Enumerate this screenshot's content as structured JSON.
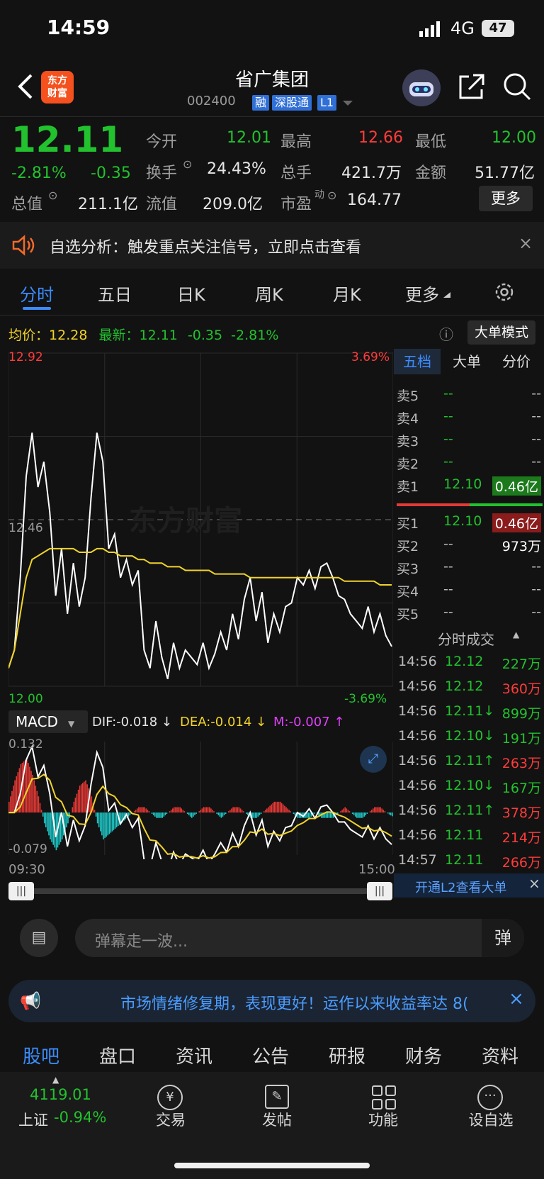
{
  "status": {
    "time": "14:59",
    "network": "4G",
    "battery": "47"
  },
  "header": {
    "logo_text_1": "东方",
    "logo_text_2": "财富",
    "title": "省广集团",
    "code": "002400",
    "tags": [
      "融",
      "深股通",
      "L1"
    ]
  },
  "quote": {
    "price": "12.11",
    "change_pct": "-2.81%",
    "change": "-0.35",
    "open_label": "今开",
    "open": "12.01",
    "high_label": "最高",
    "high": "12.66",
    "low_label": "最低",
    "low": "12.00",
    "turnover_label": "换手",
    "turnover": "24.43%",
    "volume_label": "总手",
    "volume": "421.7万",
    "amount_label": "金额",
    "amount": "51.77亿",
    "mcap_label": "总值",
    "mcap": "211.1亿",
    "float_label": "流值",
    "float": "209.0亿",
    "pe_label": "市盈",
    "pe_sup": "动",
    "pe": "164.77",
    "more_label": "更多"
  },
  "banner": {
    "text": "自选分析：触发重点关注信号，立即点击查看"
  },
  "tabs": [
    "分时",
    "五日",
    "日K",
    "周K",
    "月K",
    "更多"
  ],
  "chart_info": {
    "avg_label": "均价：",
    "avg": "12.28",
    "latest_label": "最新：",
    "latest": "12.11",
    "latest_change": "-0.35",
    "latest_pct": "-2.81%",
    "mode_label": "大单模式",
    "y_top": "12.92",
    "y_mid": "12.46",
    "y_bottom": "12.00",
    "pct_top": "3.69%",
    "pct_bottom": "-3.69%",
    "watermark": "东方财富",
    "time_start": "09:30",
    "time_end": "15:00"
  },
  "macd": {
    "label": "MACD",
    "dif": "DIF:-0.018 ↓",
    "dea": "DEA:-0.014 ↓",
    "m": "M:-0.007 ↑",
    "top": "0.132",
    "bottom": "-0.079"
  },
  "chart_data": [
    {
      "type": "line",
      "x_range": [
        "09:30",
        "15:00"
      ],
      "ylim": [
        12.0,
        12.92
      ],
      "series": [
        {
          "name": "最新",
          "color": "#ffffff",
          "values": [
            12.05,
            12.1,
            12.3,
            12.58,
            12.7,
            12.55,
            12.62,
            12.48,
            12.25,
            12.38,
            12.2,
            12.34,
            12.22,
            12.3,
            12.52,
            12.7,
            12.62,
            12.38,
            12.42,
            12.3,
            12.35,
            12.28,
            12.32,
            12.1,
            12.05,
            12.18,
            12.08,
            12.02,
            12.12,
            12.05,
            12.1,
            12.08,
            12.06,
            12.12,
            12.05,
            12.09,
            12.15,
            12.1,
            12.2,
            12.13,
            12.24,
            12.3,
            12.18,
            12.26,
            12.12,
            12.2,
            12.15,
            12.22,
            12.23,
            12.3,
            12.28,
            12.32,
            12.27,
            12.33,
            12.34,
            12.3,
            12.25,
            12.24,
            12.2,
            12.18,
            12.16,
            12.22,
            12.15,
            12.2,
            12.14,
            12.11
          ]
        },
        {
          "name": "均价",
          "color": "#f1d32a",
          "values": [
            12.05,
            12.1,
            12.2,
            12.3,
            12.35,
            12.36,
            12.37,
            12.38,
            12.38,
            12.38,
            12.38,
            12.38,
            12.37,
            12.37,
            12.37,
            12.38,
            12.38,
            12.37,
            12.37,
            12.36,
            12.36,
            12.36,
            12.35,
            12.35,
            12.34,
            12.34,
            12.34,
            12.33,
            12.33,
            12.33,
            12.32,
            12.32,
            12.32,
            12.32,
            12.32,
            12.31,
            12.31,
            12.31,
            12.31,
            12.31,
            12.31,
            12.3,
            12.3,
            12.3,
            12.3,
            12.3,
            12.3,
            12.3,
            12.3,
            12.3,
            12.3,
            12.3,
            12.3,
            12.3,
            12.3,
            12.3,
            12.3,
            12.29,
            12.29,
            12.29,
            12.29,
            12.29,
            12.29,
            12.28,
            12.28,
            12.28
          ]
        }
      ]
    },
    {
      "type": "bar",
      "ylim": [
        -0.079,
        0.132
      ],
      "series": [
        {
          "name": "M",
          "values": [
            0.02,
            0.06,
            0.09,
            0.1,
            0.07,
            0.03,
            -0.02,
            -0.05,
            -0.07,
            -0.05,
            -0.02,
            0.02,
            0.05,
            0.06,
            0.03,
            -0.02,
            -0.05,
            -0.04,
            -0.03,
            -0.02,
            -0.01,
            0.0,
            0.01,
            0.01,
            0.0,
            -0.01,
            -0.01,
            0.0,
            0.01,
            0.01,
            0.0,
            -0.01,
            0.0,
            0.01,
            0.01,
            0.0,
            -0.01,
            0.0,
            0.01,
            0.01,
            0.0,
            -0.01,
            -0.01,
            0.0,
            0.01,
            0.02,
            0.02,
            0.01,
            0.0,
            -0.01,
            -0.01,
            -0.01,
            0.0,
            -0.01,
            -0.01,
            -0.01,
            0.0,
            0.01,
            0.0,
            -0.01,
            -0.01,
            0.0,
            0.01,
            0.01,
            0.0,
            -0.007
          ]
        }
      ]
    }
  ],
  "orderbook": {
    "tabs": [
      "五档",
      "大单",
      "分价"
    ],
    "asks": [
      {
        "label": "卖5",
        "price": "--",
        "vol": "--"
      },
      {
        "label": "卖4",
        "price": "--",
        "vol": "--"
      },
      {
        "label": "卖3",
        "price": "--",
        "vol": "--"
      },
      {
        "label": "卖2",
        "price": "--",
        "vol": "--"
      },
      {
        "label": "卖1",
        "price": "12.10",
        "vol": "0.46亿"
      }
    ],
    "bids": [
      {
        "label": "买1",
        "price": "12.10",
        "vol": "0.46亿"
      },
      {
        "label": "买2",
        "price": "--",
        "vol": "973万"
      },
      {
        "label": "买3",
        "price": "--",
        "vol": "--"
      },
      {
        "label": "买4",
        "price": "--",
        "vol": "--"
      },
      {
        "label": "买5",
        "price": "--",
        "vol": "--"
      }
    ],
    "trades_title": "分时成交",
    "trades": [
      {
        "time": "14:56",
        "price": "12.12",
        "vol": "227万",
        "c": "green"
      },
      {
        "time": "14:56",
        "price": "12.12",
        "vol": "360万",
        "c": "red"
      },
      {
        "time": "14:56",
        "price": "12.11↓",
        "vol": "899万",
        "c": "green"
      },
      {
        "time": "14:56",
        "price": "12.10↓",
        "vol": "191万",
        "c": "green"
      },
      {
        "time": "14:56",
        "price": "12.11↑",
        "vol": "263万",
        "c": "red"
      },
      {
        "time": "14:56",
        "price": "12.10↓",
        "vol": "167万",
        "c": "green"
      },
      {
        "time": "14:56",
        "price": "12.11↑",
        "vol": "378万",
        "c": "red"
      },
      {
        "time": "14:56",
        "price": "12.11",
        "vol": "214万",
        "c": "red"
      },
      {
        "time": "14:57",
        "price": "12.11",
        "vol": "266万",
        "c": "red"
      }
    ],
    "l2_text": "开通L2查看大单"
  },
  "danmu": {
    "placeholder": "弹幕走一波...",
    "btn": "弹"
  },
  "promo": {
    "text": "市场情绪修复期，表现更好！运作以来收益率达 8("
  },
  "bottom_tabs": [
    "股吧",
    "盘口",
    "资讯",
    "公告",
    "研报",
    "财务",
    "资料"
  ],
  "dock": {
    "index_value": "4119.01",
    "index_name": "上证",
    "index_pct": "-0.94%",
    "items": [
      "交易",
      "发帖",
      "功能",
      "设自选"
    ]
  }
}
